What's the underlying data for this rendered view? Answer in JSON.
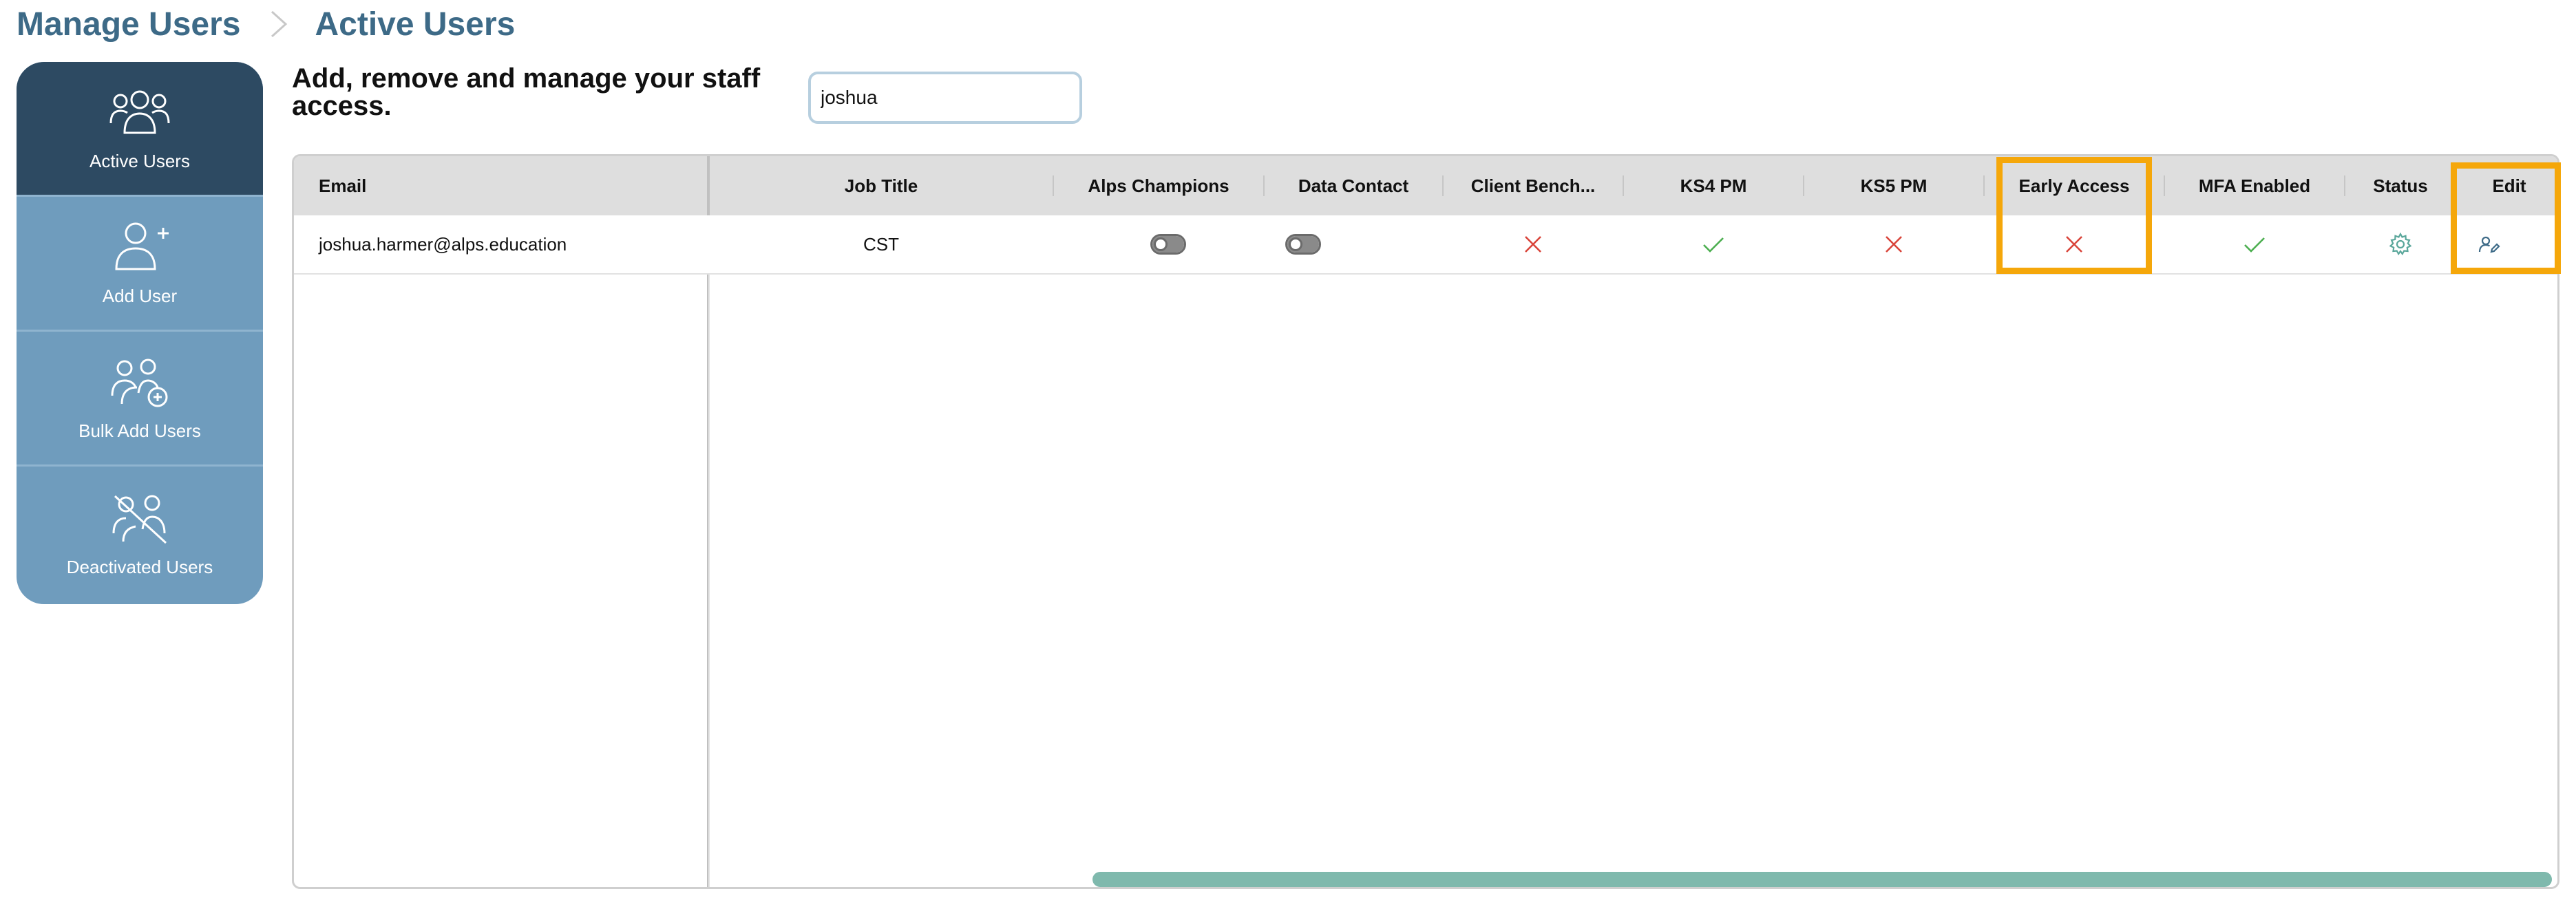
{
  "breadcrumb": {
    "parent": "Manage Users",
    "current": "Active Users"
  },
  "sidebar": {
    "items": [
      {
        "label": "Active Users",
        "icon": "users-icon",
        "active": true
      },
      {
        "label": "Add User",
        "icon": "user-plus-icon",
        "active": false
      },
      {
        "label": "Bulk Add Users",
        "icon": "users-plus-icon",
        "active": false
      },
      {
        "label": "Deactivated Users",
        "icon": "users-slash-icon",
        "active": false
      }
    ]
  },
  "intro": {
    "text": "Add, remove and manage your staff access."
  },
  "search": {
    "value": "joshua",
    "placeholder": ""
  },
  "table": {
    "columns": [
      "Email",
      "Job Title",
      "Alps Champions",
      "Data Contact",
      "Client Bench...",
      "KS4 PM",
      "KS5 PM",
      "Early Access",
      "MFA Enabled",
      "Status",
      "Edit"
    ],
    "rows": [
      {
        "email": "joshua.harmer@alps.education",
        "job_title": "CST",
        "alps_champions": false,
        "data_contact": false,
        "client_bench": false,
        "ks4_pm": true,
        "ks5_pm": false,
        "early_access": false,
        "mfa_enabled": true,
        "status_icon": "gear-icon",
        "edit_icon": "edit-user-icon"
      }
    ]
  },
  "colors": {
    "brand": "#3d6a87",
    "sidebar_active": "#2d4a62",
    "sidebar": "#6f9cbd",
    "check": "#4caf50",
    "cross": "#d9443a",
    "highlight": "#f5a70a",
    "scrollbar": "#7fb9ad"
  }
}
